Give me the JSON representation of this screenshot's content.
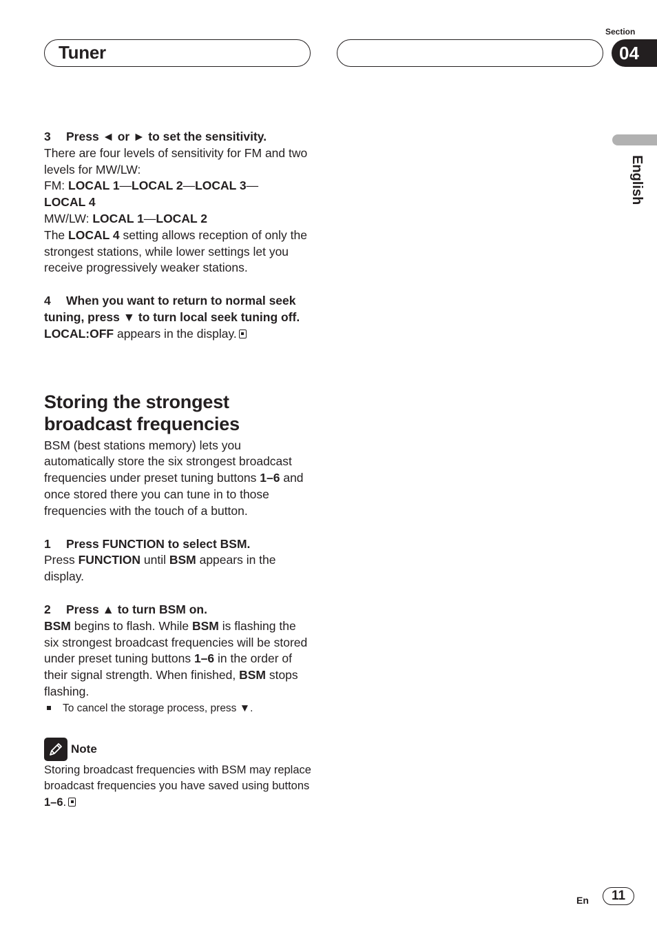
{
  "header": {
    "title": "Tuner",
    "section_label": "Section",
    "section_number": "04"
  },
  "side_tab": {
    "language": "English"
  },
  "content": {
    "step3": {
      "number": "3",
      "title": "Press ◄ or ► to set the sensitivity.",
      "line1": "There are four levels of sensitivity for FM and two levels for MW/LW:",
      "fm_prefix": "FM: ",
      "fm_levels": [
        "LOCAL 1",
        "LOCAL 2",
        "LOCAL 3",
        "LOCAL 4"
      ],
      "mwlw_prefix": "MW/LW: ",
      "mwlw_levels": [
        "LOCAL 1",
        "LOCAL 2"
      ],
      "separator": "—",
      "desc_pre": "The ",
      "desc_bold": "LOCAL 4",
      "desc_post": " setting allows reception of only the strongest stations, while lower settings let you receive progressively weaker stations."
    },
    "step4": {
      "number": "4",
      "title": "When you want to return to normal seek tuning, press ▼ to turn local seek tuning off.",
      "desc_bold": "LOCAL:OFF",
      "desc_post": " appears in the display."
    },
    "section_heading": "Storing the strongest broadcast frequencies",
    "intro_pre": "BSM (best stations memory) lets you automatically store the six strongest broadcast frequencies under preset tuning buttons ",
    "intro_bold": "1–6",
    "intro_post": " and once stored there you can tune in to those frequencies with the touch of a button.",
    "bsm_step1": {
      "number": "1",
      "title": "Press FUNCTION to select BSM.",
      "p1": "Press ",
      "b1": "FUNCTION",
      "p2": " until ",
      "b2": "BSM",
      "p3": " appears in the display."
    },
    "bsm_step2": {
      "number": "2",
      "title": "Press ▲ to turn BSM on.",
      "b1": "BSM",
      "p1": " begins to flash. While ",
      "b2": "BSM",
      "p2": " is flashing the six strongest broadcast frequencies will be stored under preset tuning buttons ",
      "b3": "1–6",
      "p3": " in the order of their signal strength. When finished, ",
      "b4": "BSM",
      "p4": " stops flashing.",
      "bullet": "To cancel the storage process, press ▼."
    },
    "note": {
      "label": "Note",
      "body_pre": "Storing broadcast frequencies with BSM may replace broadcast frequencies you have saved using buttons ",
      "body_bold": "1–6",
      "body_post": "."
    }
  },
  "footer": {
    "language_code": "En",
    "page_number": "11"
  }
}
